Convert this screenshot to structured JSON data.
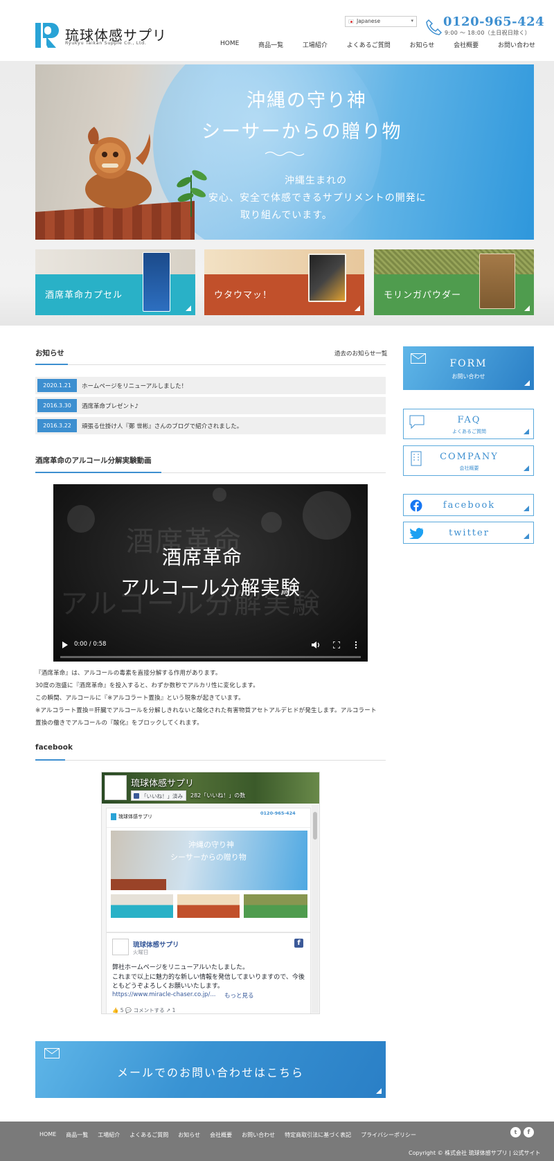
{
  "header": {
    "logo_name": "琉球体感サプリ",
    "logo_sub": "Ryukyu Taikan Supple Co., Ltd.",
    "language": "Japanese",
    "phone": "0120-965-424",
    "hours": "9:00 ～ 18:00（土日祝日除く）",
    "nav": [
      "HOME",
      "商品一覧",
      "工場紹介",
      "よくあるご質問",
      "お知らせ",
      "会社概要",
      "お問い合わせ"
    ]
  },
  "hero": {
    "title_line1": "沖縄の守り神",
    "title_line2": "シーサーからの贈り物",
    "text_line1": "沖縄生まれの",
    "text_line2": "安心、安全で体感できるサプリメントの開発に",
    "text_line3": "取り組んでいます。"
  },
  "products": [
    {
      "label": "酒席革命カプセル",
      "color": "#29b1c7"
    },
    {
      "label": "ウタウマッ！",
      "color": "#c1502b"
    },
    {
      "label": "モリンガパウダー",
      "color": "#4f9c4e"
    }
  ],
  "news": {
    "title": "お知らせ",
    "archive_link": "過去のお知らせ一覧",
    "items": [
      {
        "date": "2020.1.21",
        "text": "ホームページをリニューアルしました！"
      },
      {
        "date": "2016.3.30",
        "text": "酒席革命プレゼント♪"
      },
      {
        "date": "2016.3.22",
        "text": "頑張る仕掛け人『鄭 世彬』さんのブログで紹介されました。"
      }
    ]
  },
  "video": {
    "section_title": "酒席革命のアルコール分解実験動画",
    "title_line1": "酒席革命",
    "title_line2": "アルコール分解実験",
    "time": "0:00 / 0:58"
  },
  "description": [
    "『酒席革命』は、アルコールの毒素を直接分解する作用があります。",
    "30度の泡盛に『酒席革命』を投入すると、わずか数秒でアルカリ性に変化します。",
    "この瞬間、アルコールに『※アルコラート置換』という現象が起きています。",
    "※アルコラート置換＝肝臓でアルコールを分解しきれないと酸化された有害物質アセトアルデヒドが発生します。アルコラート",
    "置換の働きでアルコールの『酸化』をブロックしてくれます。"
  ],
  "facebook": {
    "section_title": "facebook",
    "page_name": "琉球体感サプリ",
    "like_button": "「いいね！」済み",
    "likes_count": "282「いいね！」の数",
    "post_name": "琉球体感サプリ",
    "post_date": "火曜日",
    "post_line1": "弊社ホームページをリニューアルいたしました。",
    "post_line2": "これまで以上に魅力的な新しい情報を発信してまいりますので、今後",
    "post_line3": "ともどうぞよろしくお願いいたします。",
    "post_link": "https://www.miracle-chaser.co.jp/...",
    "post_more": "もっと見る",
    "post_actions": "👍 5   💬 コメントする   ↗ 1"
  },
  "mail_banner": "メールでのお問い合わせはこちら",
  "sidebar": {
    "form_title": "FORM",
    "form_sub": "お問い合わせ",
    "faq_title": "FAQ",
    "faq_sub": "よくあるご質問",
    "company_title": "COMPANY",
    "company_sub": "会社概要",
    "facebook": "facebook",
    "twitter": "twitter"
  },
  "footer": {
    "nav": [
      "HOME",
      "商品一覧",
      "工場紹介",
      "よくあるご質問",
      "お知らせ",
      "会社概要",
      "お問い合わせ",
      "特定商取引法に基づく表記",
      "プライバシーポリシー"
    ],
    "copyright": "Copyright © 株式会社 琉球体感サプリ | 公式サイト"
  },
  "colors": {
    "accent": "#3d8fd0",
    "footer": "#7a7a7a"
  }
}
